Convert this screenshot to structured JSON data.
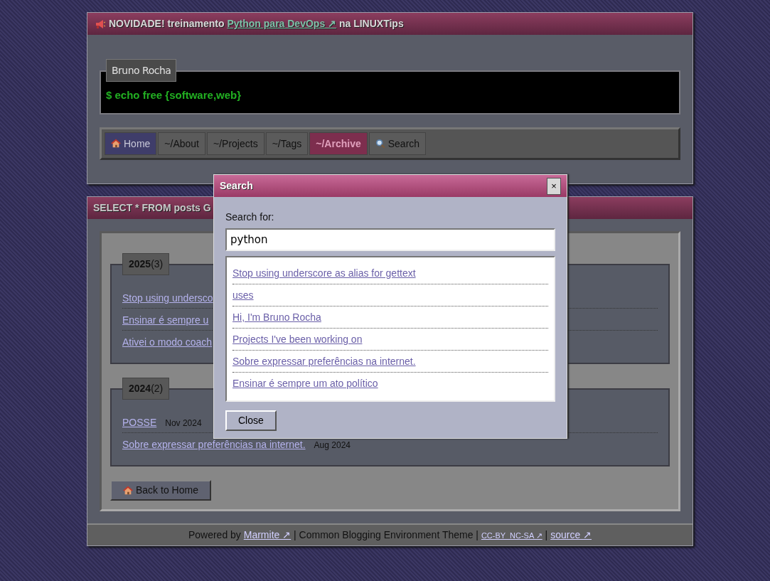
{
  "announcement": {
    "before": "NOVIDADE! treinamento",
    "link": "Python para DevOps ↗",
    "after": "na LINUXTips"
  },
  "site": {
    "author": "Bruno Rocha",
    "tagline": "$ echo free {software,web}"
  },
  "nav": [
    {
      "label": "Home",
      "kind": "home",
      "selected": false
    },
    {
      "label": "~/About",
      "kind": "page",
      "selected": false
    },
    {
      "label": "~/Projects",
      "kind": "page",
      "selected": false
    },
    {
      "label": "~/Tags",
      "kind": "page",
      "selected": false
    },
    {
      "label": "~/Archive",
      "kind": "page",
      "selected": true
    },
    {
      "label": "Search",
      "kind": "search",
      "selected": false
    }
  ],
  "archive": {
    "title": "SELECT * FROM posts G",
    "groups": [
      {
        "year": "2025",
        "count": "(3)",
        "posts": [
          {
            "title": "Stop using undersco"
          },
          {
            "title": "Ensinar é sempre u"
          },
          {
            "title": "Ativei o modo coach"
          }
        ]
      },
      {
        "year": "2024",
        "count": "(2)",
        "posts": [
          {
            "title": "POSSE",
            "date": "Nov 2024"
          },
          {
            "title": "Sobre expressar preferências na internet.",
            "date": "Aug 2024"
          }
        ]
      }
    ],
    "back_button": "Back to Home"
  },
  "footer": [
    {
      "kind": "text",
      "text": "Powered by"
    },
    {
      "kind": "link",
      "text": "Marmite ↗"
    },
    {
      "kind": "text",
      "text": "| Common Blogging Environment Theme |"
    },
    {
      "kind": "small_link",
      "text": "CC-BY  NC-SA ↗"
    },
    {
      "kind": "text",
      "text": "|"
    },
    {
      "kind": "link",
      "text": "source ↗"
    }
  ],
  "search_dialog": {
    "title": "Search",
    "close_icon": "×",
    "label": "Search for:",
    "query": "python",
    "results": [
      "Stop using underscore as alias for gettext",
      "uses",
      "Hi, I'm Bruno Rocha",
      "Projects I've been working on",
      "Sobre expressar preferências na internet.",
      "Ensinar é sempre um ato político"
    ],
    "close_button": "Close"
  }
}
